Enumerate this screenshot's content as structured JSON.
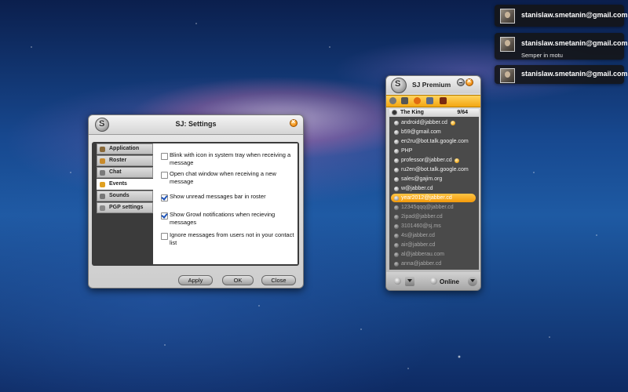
{
  "notifications": [
    {
      "title": "stanislaw.smetanin@gmail.com",
      "text": ""
    },
    {
      "title": "stanislaw.smetanin@gmail.com",
      "text": "Semper in motu"
    },
    {
      "title": "stanislaw.smetanin@gmail.com",
      "text": ""
    }
  ],
  "settings": {
    "title": "SJ: Settings",
    "tabs": [
      {
        "label": "Application",
        "icon": "person-icon",
        "color": "#8a6a3a"
      },
      {
        "label": "Roster",
        "icon": "people-icon",
        "color": "#c98a2a"
      },
      {
        "label": "Chat",
        "icon": "chat-icon",
        "color": "#7a7a7a"
      },
      {
        "label": "Events",
        "icon": "bell-icon",
        "color": "#e0a020"
      },
      {
        "label": "Sounds",
        "icon": "speaker-icon",
        "color": "#777777"
      },
      {
        "label": "PGP settings",
        "icon": "key-icon",
        "color": "#888888"
      }
    ],
    "active_tab": "Events",
    "options": [
      {
        "label": "Blink with icon in system tray when receiving a message",
        "checked": false
      },
      {
        "label": "Open chat window when receiving a new message",
        "checked": false
      },
      {
        "label": "Show unread messages bar in roster",
        "checked": true
      },
      {
        "label": "Show Growl notifications when recieving messages",
        "checked": true
      },
      {
        "label": "Ignore messages from users not in your contact list",
        "checked": false
      }
    ],
    "buttons": {
      "apply": "Apply",
      "ok": "OK",
      "close": "Close"
    }
  },
  "roster": {
    "title": "SJ Premium",
    "accent": "#f5a613",
    "toolbar_icons": [
      "contacts-icon",
      "speaker-icon",
      "smiley-icon",
      "chat-icon",
      "book-icon"
    ],
    "group": {
      "name": "The King",
      "count": "9/64"
    },
    "contacts": [
      {
        "name": "android@jabber.cd",
        "state": "online",
        "extra": true
      },
      {
        "name": "b59@gmail.com",
        "state": "online",
        "extra": false
      },
      {
        "name": "en2ru@bot.talk.google.com",
        "state": "online",
        "extra": false
      },
      {
        "name": "PHP",
        "state": "online",
        "extra": false
      },
      {
        "name": "professor@jabber.cd",
        "state": "online",
        "extra": true
      },
      {
        "name": "ru2en@bot.talk.google.com",
        "state": "online",
        "extra": false
      },
      {
        "name": "sales@gajim.org",
        "state": "online",
        "extra": false
      },
      {
        "name": "w@jabber.cd",
        "state": "online",
        "extra": false
      },
      {
        "name": "year2012@jabber.cd",
        "state": "selected",
        "extra": false
      },
      {
        "name": "12345qqq@jabber.cd",
        "state": "offline",
        "extra": false
      },
      {
        "name": "2ipad@jabber.cd",
        "state": "offline",
        "extra": false
      },
      {
        "name": "3101460@sj.ms",
        "state": "offline",
        "extra": false
      },
      {
        "name": "4s@jabber.cd",
        "state": "offline",
        "extra": false
      },
      {
        "name": "air@jabber.cd",
        "state": "offline",
        "extra": false
      },
      {
        "name": "al@jabberau.com",
        "state": "offline",
        "extra": false
      },
      {
        "name": "anna@jabber.cd",
        "state": "offline",
        "extra": false
      }
    ],
    "status": "Online"
  }
}
